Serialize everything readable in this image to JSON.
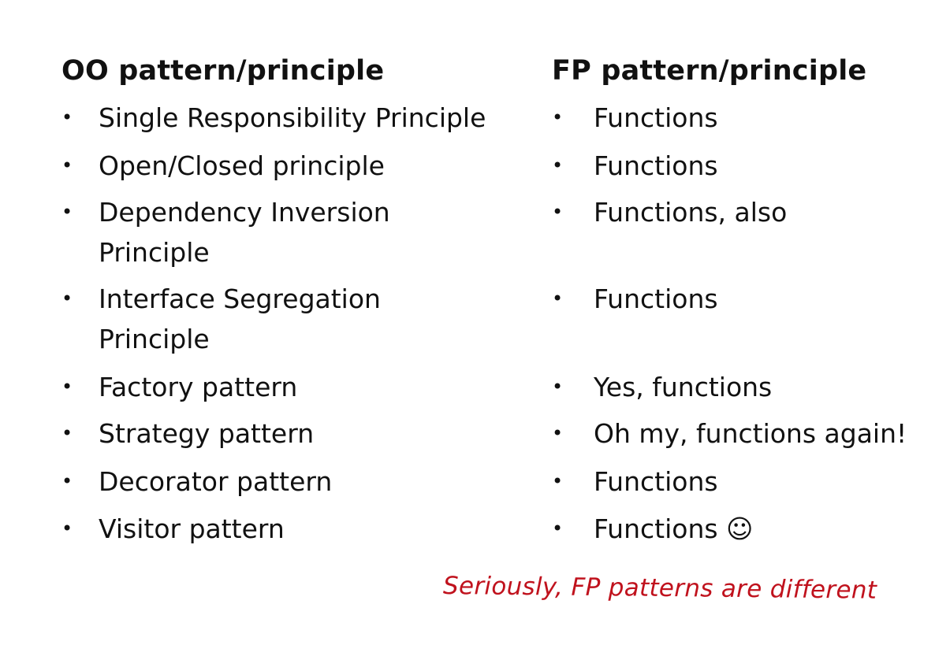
{
  "oo": {
    "title": "OO pattern/principle",
    "items": [
      {
        "lines": [
          "Single Responsibility Principle"
        ]
      },
      {
        "lines": [
          "Open/Closed principle"
        ]
      },
      {
        "lines": [
          "Dependency Inversion",
          "Principle"
        ]
      },
      {
        "lines": [
          "Interface Segregation",
          "Principle"
        ]
      },
      {
        "lines": [
          "Factory pattern"
        ]
      },
      {
        "lines": [
          "Strategy pattern"
        ]
      },
      {
        "lines": [
          "Decorator pattern"
        ]
      },
      {
        "lines": [
          "Visitor pattern"
        ]
      }
    ]
  },
  "fp": {
    "title": "FP pattern/principle",
    "items": [
      {
        "text": "Functions"
      },
      {
        "text": "Functions"
      },
      {
        "text": "Functions, also"
      },
      {
        "text": "Functions"
      },
      {
        "text": "Yes, functions"
      },
      {
        "text": "Oh my, functions again!"
      },
      {
        "text": "Functions"
      },
      {
        "text": "Functions ☺"
      }
    ]
  },
  "bullet": "•",
  "note": "Seriously, FP patterns are different"
}
